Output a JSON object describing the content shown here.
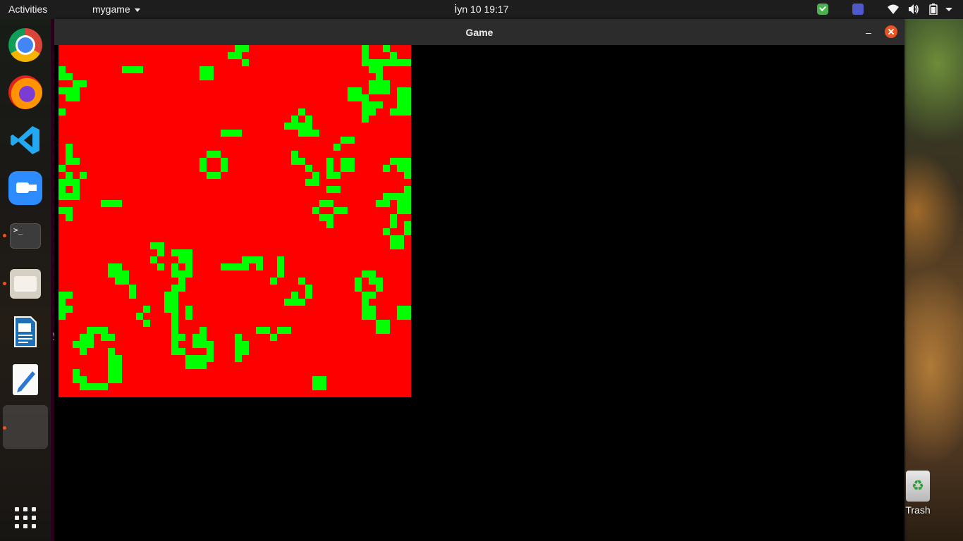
{
  "topbar": {
    "activities": "Activities",
    "app_menu": "mygame",
    "clock": "İyn 10  19:17"
  },
  "dock": {
    "items": [
      "chrome",
      "firefox",
      "vscode",
      "zoom",
      "terminal",
      "files",
      "libreoffice-writer",
      "text-editor",
      "mygame",
      "show-applications"
    ]
  },
  "window": {
    "title": "Game"
  },
  "game": {
    "grid_cols": 50,
    "grid_rows": 50,
    "dead_color": "#ff0000",
    "alive_color": "#00ff00",
    "alive_cells": [
      [
        25,
        0
      ],
      [
        26,
        0
      ],
      [
        43,
        0
      ],
      [
        46,
        0
      ],
      [
        24,
        1
      ],
      [
        25,
        1
      ],
      [
        43,
        1
      ],
      [
        47,
        1
      ],
      [
        26,
        2
      ],
      [
        43,
        2
      ],
      [
        44,
        2
      ],
      [
        45,
        2
      ],
      [
        46,
        2
      ],
      [
        47,
        2
      ],
      [
        48,
        2
      ],
      [
        49,
        2
      ],
      [
        0,
        3
      ],
      [
        9,
        3
      ],
      [
        10,
        3
      ],
      [
        11,
        3
      ],
      [
        20,
        3
      ],
      [
        21,
        3
      ],
      [
        44,
        3
      ],
      [
        45,
        3
      ],
      [
        0,
        4
      ],
      [
        1,
        4
      ],
      [
        20,
        4
      ],
      [
        21,
        4
      ],
      [
        45,
        4
      ],
      [
        2,
        5
      ],
      [
        3,
        5
      ],
      [
        44,
        5
      ],
      [
        45,
        5
      ],
      [
        46,
        5
      ],
      [
        0,
        6
      ],
      [
        1,
        6
      ],
      [
        2,
        6
      ],
      [
        41,
        6
      ],
      [
        42,
        6
      ],
      [
        44,
        6
      ],
      [
        45,
        6
      ],
      [
        46,
        6
      ],
      [
        48,
        6
      ],
      [
        49,
        6
      ],
      [
        1,
        7
      ],
      [
        2,
        7
      ],
      [
        41,
        7
      ],
      [
        42,
        7
      ],
      [
        43,
        7
      ],
      [
        48,
        7
      ],
      [
        49,
        7
      ],
      [
        43,
        8
      ],
      [
        44,
        8
      ],
      [
        45,
        8
      ],
      [
        48,
        8
      ],
      [
        49,
        8
      ],
      [
        0,
        9
      ],
      [
        34,
        9
      ],
      [
        43,
        9
      ],
      [
        44,
        9
      ],
      [
        47,
        9
      ],
      [
        48,
        9
      ],
      [
        49,
        9
      ],
      [
        33,
        10
      ],
      [
        35,
        10
      ],
      [
        43,
        10
      ],
      [
        32,
        11
      ],
      [
        33,
        11
      ],
      [
        34,
        11
      ],
      [
        35,
        11
      ],
      [
        34,
        12
      ],
      [
        35,
        12
      ],
      [
        36,
        12
      ],
      [
        23,
        12
      ],
      [
        24,
        12
      ],
      [
        25,
        12
      ],
      [
        40,
        13
      ],
      [
        41,
        13
      ],
      [
        39,
        14
      ],
      [
        1,
        14
      ],
      [
        1,
        15
      ],
      [
        21,
        15
      ],
      [
        22,
        15
      ],
      [
        33,
        15
      ],
      [
        1,
        16
      ],
      [
        2,
        16
      ],
      [
        20,
        16
      ],
      [
        23,
        16
      ],
      [
        33,
        16
      ],
      [
        34,
        16
      ],
      [
        38,
        16
      ],
      [
        40,
        16
      ],
      [
        41,
        16
      ],
      [
        47,
        16
      ],
      [
        48,
        16
      ],
      [
        49,
        16
      ],
      [
        0,
        17
      ],
      [
        20,
        17
      ],
      [
        23,
        17
      ],
      [
        35,
        17
      ],
      [
        38,
        17
      ],
      [
        40,
        17
      ],
      [
        41,
        17
      ],
      [
        46,
        17
      ],
      [
        48,
        17
      ],
      [
        49,
        17
      ],
      [
        1,
        18
      ],
      [
        3,
        18
      ],
      [
        21,
        18
      ],
      [
        22,
        18
      ],
      [
        36,
        18
      ],
      [
        38,
        18
      ],
      [
        39,
        18
      ],
      [
        49,
        18
      ],
      [
        0,
        19
      ],
      [
        1,
        19
      ],
      [
        2,
        19
      ],
      [
        35,
        19
      ],
      [
        36,
        19
      ],
      [
        0,
        20
      ],
      [
        2,
        20
      ],
      [
        38,
        20
      ],
      [
        39,
        20
      ],
      [
        49,
        20
      ],
      [
        0,
        21
      ],
      [
        1,
        21
      ],
      [
        2,
        21
      ],
      [
        46,
        21
      ],
      [
        47,
        21
      ],
      [
        48,
        21
      ],
      [
        49,
        21
      ],
      [
        6,
        22
      ],
      [
        7,
        22
      ],
      [
        8,
        22
      ],
      [
        37,
        22
      ],
      [
        38,
        22
      ],
      [
        45,
        22
      ],
      [
        46,
        22
      ],
      [
        48,
        22
      ],
      [
        49,
        22
      ],
      [
        0,
        23
      ],
      [
        1,
        23
      ],
      [
        36,
        23
      ],
      [
        39,
        23
      ],
      [
        40,
        23
      ],
      [
        48,
        23
      ],
      [
        49,
        23
      ],
      [
        1,
        24
      ],
      [
        37,
        24
      ],
      [
        38,
        24
      ],
      [
        47,
        24
      ],
      [
        38,
        25
      ],
      [
        47,
        25
      ],
      [
        49,
        25
      ],
      [
        46,
        26
      ],
      [
        49,
        26
      ],
      [
        47,
        27
      ],
      [
        48,
        27
      ],
      [
        47,
        28
      ],
      [
        48,
        28
      ],
      [
        13,
        28
      ],
      [
        14,
        28
      ],
      [
        14,
        29
      ],
      [
        16,
        29
      ],
      [
        17,
        29
      ],
      [
        18,
        29
      ],
      [
        13,
        30
      ],
      [
        17,
        30
      ],
      [
        18,
        30
      ],
      [
        26,
        30
      ],
      [
        27,
        30
      ],
      [
        28,
        30
      ],
      [
        31,
        30
      ],
      [
        14,
        31
      ],
      [
        16,
        31
      ],
      [
        18,
        31
      ],
      [
        23,
        31
      ],
      [
        24,
        31
      ],
      [
        25,
        31
      ],
      [
        26,
        31
      ],
      [
        28,
        31
      ],
      [
        31,
        31
      ],
      [
        7,
        31
      ],
      [
        8,
        31
      ],
      [
        7,
        32
      ],
      [
        8,
        32
      ],
      [
        9,
        32
      ],
      [
        16,
        32
      ],
      [
        17,
        32
      ],
      [
        18,
        32
      ],
      [
        31,
        32
      ],
      [
        43,
        32
      ],
      [
        44,
        32
      ],
      [
        8,
        33
      ],
      [
        9,
        33
      ],
      [
        17,
        33
      ],
      [
        30,
        33
      ],
      [
        34,
        33
      ],
      [
        42,
        33
      ],
      [
        44,
        33
      ],
      [
        45,
        33
      ],
      [
        10,
        34
      ],
      [
        16,
        34
      ],
      [
        17,
        34
      ],
      [
        35,
        34
      ],
      [
        42,
        34
      ],
      [
        45,
        34
      ],
      [
        10,
        35
      ],
      [
        15,
        35
      ],
      [
        16,
        35
      ],
      [
        33,
        35
      ],
      [
        35,
        35
      ],
      [
        43,
        35
      ],
      [
        44,
        35
      ],
      [
        0,
        35
      ],
      [
        1,
        35
      ],
      [
        16,
        36
      ],
      [
        32,
        36
      ],
      [
        33,
        36
      ],
      [
        0,
        36
      ],
      [
        15,
        36
      ],
      [
        34,
        36
      ],
      [
        43,
        36
      ],
      [
        0,
        37
      ],
      [
        1,
        37
      ],
      [
        12,
        37
      ],
      [
        15,
        37
      ],
      [
        16,
        37
      ],
      [
        18,
        37
      ],
      [
        49,
        37
      ],
      [
        48,
        37
      ],
      [
        0,
        38
      ],
      [
        11,
        38
      ],
      [
        16,
        38
      ],
      [
        18,
        38
      ],
      [
        48,
        38
      ],
      [
        49,
        38
      ],
      [
        12,
        39
      ],
      [
        16,
        39
      ],
      [
        45,
        39
      ],
      [
        46,
        39
      ],
      [
        5,
        40
      ],
      [
        6,
        40
      ],
      [
        16,
        40
      ],
      [
        45,
        40
      ],
      [
        46,
        40
      ],
      [
        4,
        40
      ],
      [
        16,
        41
      ],
      [
        17,
        41
      ],
      [
        20,
        40
      ],
      [
        28,
        40
      ],
      [
        29,
        40
      ],
      [
        31,
        40
      ],
      [
        32,
        40
      ],
      [
        3,
        41
      ],
      [
        4,
        41
      ],
      [
        6,
        41
      ],
      [
        7,
        41
      ],
      [
        17,
        41
      ],
      [
        19,
        41
      ],
      [
        20,
        41
      ],
      [
        25,
        41
      ],
      [
        30,
        41
      ],
      [
        3,
        42
      ],
      [
        20,
        42
      ],
      [
        19,
        42
      ],
      [
        21,
        42
      ],
      [
        25,
        42
      ],
      [
        26,
        42
      ],
      [
        16,
        42
      ],
      [
        4,
        42
      ],
      [
        16,
        43
      ],
      [
        26,
        43
      ],
      [
        25,
        43
      ],
      [
        21,
        43
      ],
      [
        3,
        43
      ],
      [
        7,
        43
      ],
      [
        17,
        43
      ],
      [
        7,
        44
      ],
      [
        18,
        44
      ],
      [
        19,
        44
      ],
      [
        20,
        44
      ],
      [
        21,
        44
      ],
      [
        8,
        44
      ],
      [
        7,
        45
      ],
      [
        18,
        45
      ],
      [
        19,
        45
      ],
      [
        20,
        45
      ],
      [
        8,
        45
      ],
      [
        2,
        46
      ],
      [
        8,
        46
      ],
      [
        7,
        46
      ],
      [
        2,
        47
      ],
      [
        3,
        47
      ],
      [
        8,
        47
      ],
      [
        7,
        47
      ],
      [
        36,
        47
      ],
      [
        37,
        47
      ],
      [
        3,
        48
      ],
      [
        4,
        48
      ],
      [
        5,
        48
      ],
      [
        6,
        48
      ],
      [
        36,
        48
      ],
      [
        37,
        48
      ],
      [
        43,
        37
      ],
      [
        44,
        37
      ],
      [
        43,
        38
      ],
      [
        44,
        38
      ],
      [
        4,
        42
      ],
      [
        2,
        42
      ],
      [
        25,
        44
      ]
    ]
  },
  "terminal_behind": {
    "lines": [
      "[",
      "[",
      "[",
      "[",
      "[",
      "[",
      "[",
      "[",
      "[",
      "[",
      "[",
      "[",
      "[",
      "[",
      "[",
      "[",
      "[",
      "[",
      "[",
      "[",
      "[",
      "[",
      "y"
    ]
  },
  "desktop": {
    "trash_label": "Trash"
  }
}
